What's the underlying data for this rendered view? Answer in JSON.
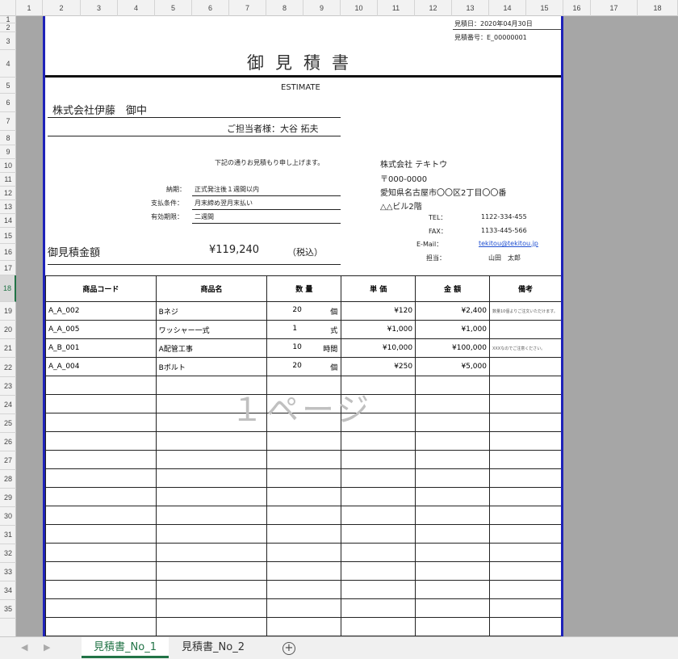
{
  "columns": [
    "1",
    "2",
    "3",
    "4",
    "5",
    "6",
    "7",
    "8",
    "9",
    "10",
    "11",
    "12",
    "13",
    "14",
    "15",
    "16",
    "17",
    "18"
  ],
  "rows": [
    "1",
    "2",
    "3",
    "4",
    "5",
    "6",
    "7",
    "8",
    "9",
    "10",
    "11",
    "12",
    "13",
    "14",
    "15",
    "16",
    "17",
    "18",
    "19",
    "20",
    "21",
    "22",
    "23",
    "24",
    "25",
    "26",
    "27",
    "28",
    "29",
    "30",
    "31",
    "32",
    "33",
    "34",
    "35"
  ],
  "doc": {
    "issue_date": "見積日：2020年04月30日",
    "doc_number": "見積番号：E_00000001",
    "title": "御見積書",
    "estimate": "ESTIMATE",
    "customer": "株式会社伊藤　御中",
    "contact": "ご担当者様：大谷 拓夫",
    "intro": "下記の通りお見積もり申し上げます。",
    "delivery_label": "納期：",
    "delivery_value": "正式発注後１週間以内",
    "payment_label": "支払条件：",
    "payment_value": "月末締め翌月末払い",
    "validity_label": "有効期限：",
    "validity_value": "二週間",
    "total_label": "御見積金額",
    "total_value": "¥119,240",
    "tax_label": "（税込）",
    "company_name": "株式会社 テキトウ",
    "postal": "〒000-0000",
    "address1": "愛知県名古屋市〇〇区2丁目〇〇番",
    "address2": "△△ビル2階",
    "tel_label": "TEL：",
    "tel_value": "1122-334-455",
    "fax_label": "FAX：",
    "fax_value": "1133-445-566",
    "email_label": "E-Mail：",
    "email_value": "tekitou@tekitou.jp",
    "staff_label": "担当：",
    "staff_value": "山田　太郎"
  },
  "table": {
    "headers": [
      "商品コード",
      "商品名",
      "数 量",
      "単 価",
      "金 額",
      "備考"
    ],
    "rows": [
      {
        "code": "A_A_002",
        "name": "Bネジ",
        "qty": "20",
        "unit": "個",
        "price": "¥120",
        "amount": "¥2,400",
        "note": "数量10個よりご注文いただけます。"
      },
      {
        "code": "A_A_005",
        "name": "ワッシャー一式",
        "qty": "1",
        "unit": "式",
        "price": "¥1,000",
        "amount": "¥1,000",
        "note": ""
      },
      {
        "code": "A_B_001",
        "name": "A配管工事",
        "qty": "10",
        "unit": "時間",
        "price": "¥10,000",
        "amount": "¥100,000",
        "note": "XXXなのでご注意ください。"
      },
      {
        "code": "A_A_004",
        "name": "Bボルト",
        "qty": "20",
        "unit": "個",
        "price": "¥250",
        "amount": "¥5,000",
        "note": ""
      }
    ]
  },
  "watermark": "１ページ",
  "sheets": [
    "見積書_No_1",
    "見積書_No_2"
  ],
  "add_sheet": "+",
  "colors": {
    "page_border": "#1e22b8",
    "active": "#217346"
  }
}
